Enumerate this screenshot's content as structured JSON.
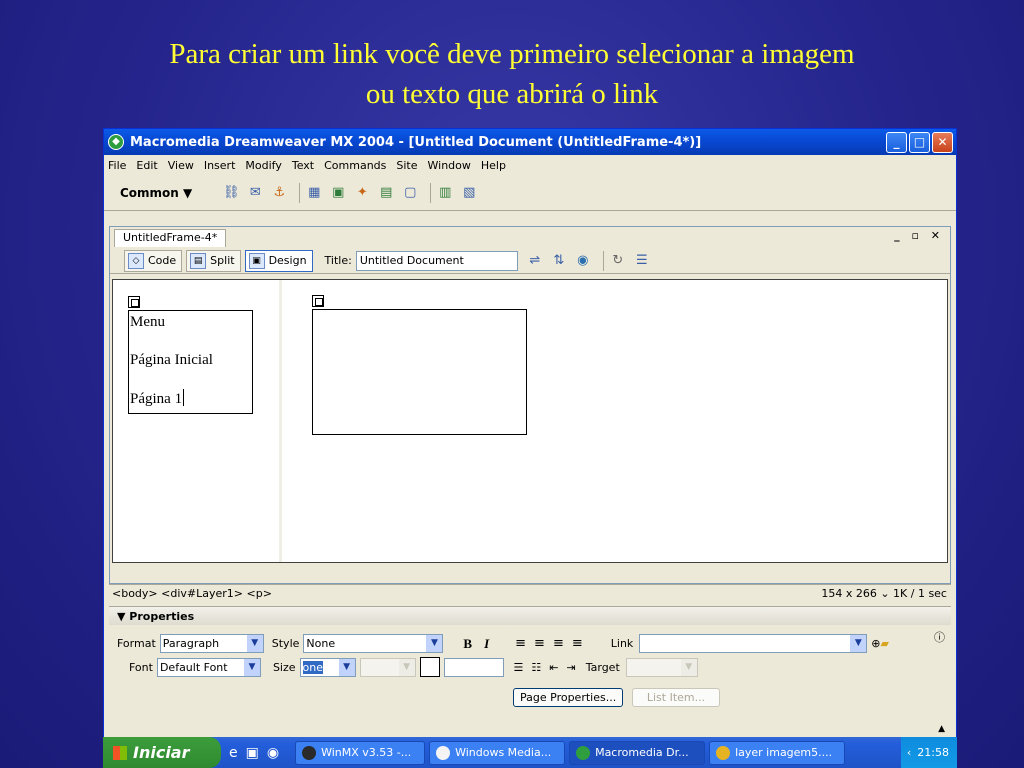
{
  "slide": {
    "caption_line1": "Para criar um link você deve primeiro selecionar a imagem",
    "caption_line2": "ou texto que abrirá o link"
  },
  "window": {
    "title": "Macromedia Dreamweaver MX 2004 - [Untitled Document (UntitledFrame-4*)]",
    "menu": [
      "File",
      "Edit",
      "View",
      "Insert",
      "Modify",
      "Text",
      "Commands",
      "Site",
      "Window",
      "Help"
    ],
    "insert_category": "Common"
  },
  "document": {
    "tab_name": "UntitledFrame-4*",
    "view_code": "Code",
    "view_split": "Split",
    "view_design": "Design",
    "title_label": "Title:",
    "title_value": "Untitled Document",
    "layer1_lines": [
      "Menu",
      "Página Inicial",
      "Página 1"
    ]
  },
  "statusbar": {
    "tag_selector": "<body> <div#Layer1> <p>",
    "info": "154 x 266 ⌄ 1K / 1 sec"
  },
  "properties": {
    "header": "Properties",
    "format_label": "Format",
    "format_value": "Paragraph",
    "style_label": "Style",
    "style_value": "None",
    "link_label": "Link",
    "link_value": "",
    "font_label": "Font",
    "font_value": "Default Font",
    "size_label": "Size",
    "size_value": "one",
    "target_label": "Target",
    "page_properties": "Page Properties...",
    "list_item": "List Item..."
  },
  "taskbar": {
    "start": "Iniciar",
    "tasks": [
      "WinMX v3.53 -...",
      "Windows Media...",
      "Macromedia Dr...",
      "layer imagem5...."
    ],
    "clock": "21:58"
  },
  "colors": {
    "slide_bg": "#24248c",
    "caption": "#ffff33",
    "titlebar": "#0847d0"
  }
}
